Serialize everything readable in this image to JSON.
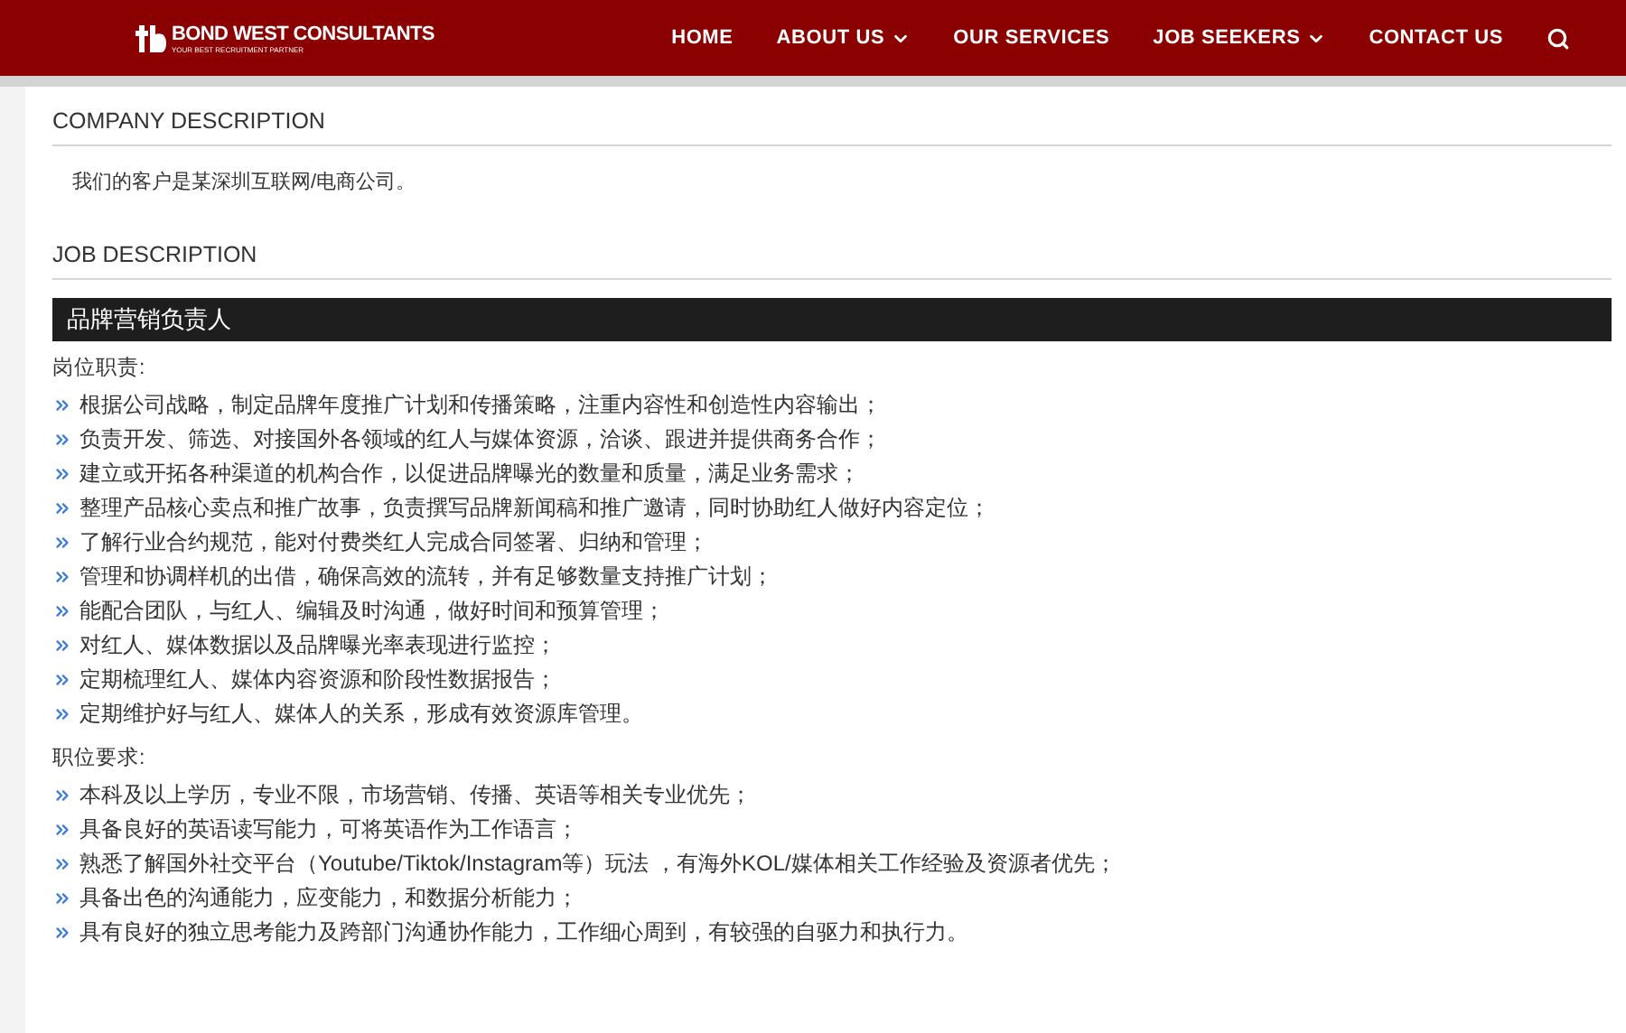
{
  "header": {
    "brand": "BOND WEST CONSULTANTS",
    "tagline": "YOUR BEST RECRUITMENT PARTNER",
    "nav": [
      {
        "label": "HOME",
        "dropdown": false
      },
      {
        "label": "ABOUT US",
        "dropdown": true
      },
      {
        "label": "OUR SERVICES",
        "dropdown": false
      },
      {
        "label": "JOB SEEKERS",
        "dropdown": true
      },
      {
        "label": "CONTACT US",
        "dropdown": false
      }
    ]
  },
  "company": {
    "heading": "COMPANY DESCRIPTION",
    "text": "我们的客户是某深圳互联网/电商公司。"
  },
  "job": {
    "heading": "JOB DESCRIPTION",
    "title": "品牌营销负责人",
    "sections": [
      {
        "label": "岗位职责:",
        "items": [
          "根据公司战略，制定品牌年度推广计划和传播策略，注重内容性和创造性内容输出；",
          "负责开发、筛选、对接国外各领域的红人与媒体资源，洽谈、跟进并提供商务合作；",
          "建立或开拓各种渠道的机构合作，以促进品牌曝光的数量和质量，满足业务需求；",
          "整理产品核心卖点和推广故事，负责撰写品牌新闻稿和推广邀请，同时协助红人做好内容定位；",
          "了解行业合约规范，能对付费类红人完成合同签署、归纳和管理；",
          "管理和协调样机的出借，确保高效的流转，并有足够数量支持推广计划；",
          "能配合团队，与红人、编辑及时沟通，做好时间和预算管理；",
          "对红人、媒体数据以及品牌曝光率表现进行监控；",
          "定期梳理红人、媒体内容资源和阶段性数据报告；",
          "定期维护好与红人、媒体人的关系，形成有效资源库管理。"
        ]
      },
      {
        "label": "职位要求:",
        "items": [
          "本科及以上学历，专业不限，市场营销、传播、英语等相关专业优先；",
          "具备良好的英语读写能力，可将英语作为工作语言；",
          "熟悉了解国外社交平台（Youtube/Tiktok/Instagram等）玩法 ，有海外KOL/媒体相关工作经验及资源者优先；",
          "具备出色的沟通能力，应变能力，和数据分析能力；",
          "具有良好的独立思考能力及跨部门沟通协作能力，工作细心周到，有较强的自驱力和执行力。"
        ]
      }
    ]
  }
}
